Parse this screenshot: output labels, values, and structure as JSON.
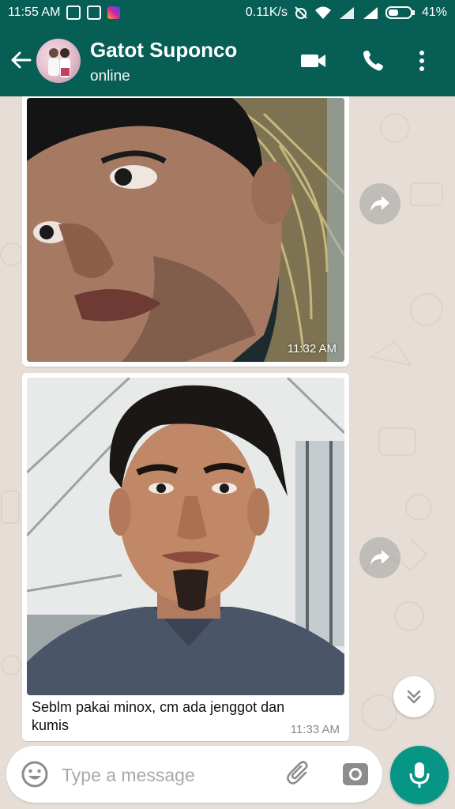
{
  "status_bar": {
    "time": "11:55 AM",
    "network_speed": "0.11K/s",
    "battery": "41%"
  },
  "header": {
    "contact_name": "Gatot Suponco",
    "contact_status": "online"
  },
  "messages": [
    {
      "type": "image",
      "time": "11:32 AM"
    },
    {
      "type": "image",
      "caption": "Seblm pakai minox, cm ada jenggot dan kumis",
      "time": "11:33 AM"
    }
  ],
  "composer": {
    "placeholder": "Type a message"
  },
  "colors": {
    "header_bg": "#075e55",
    "chat_bg": "#e6ded6",
    "mic_button": "#079685"
  },
  "icons": [
    "back-arrow-icon",
    "video-call-icon",
    "phone-icon",
    "more-options-icon",
    "forward-icon",
    "scroll-down-icon",
    "emoji-icon",
    "attach-icon",
    "camera-icon",
    "mic-icon"
  ]
}
